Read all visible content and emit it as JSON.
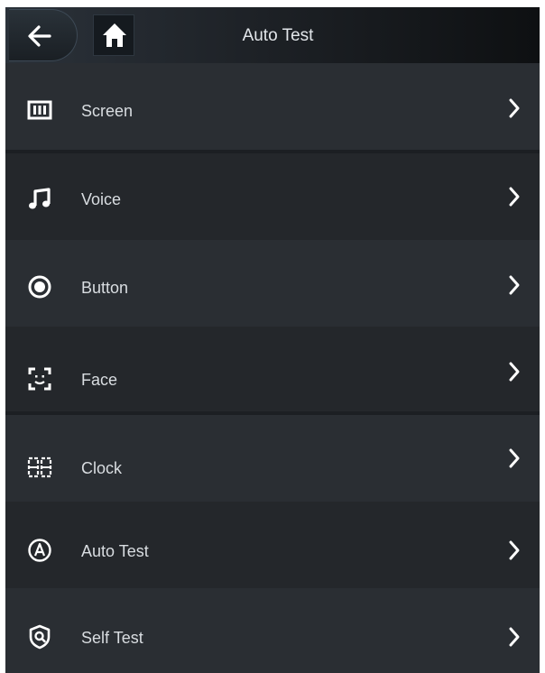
{
  "header": {
    "title": "Auto Test",
    "back_icon": "arrow-left-icon",
    "home_icon": "home-icon"
  },
  "menu": {
    "items": [
      {
        "label": "Screen",
        "icon": "screen-icon"
      },
      {
        "label": "Voice",
        "icon": "music-note-icon"
      },
      {
        "label": "Button",
        "icon": "radio-button-icon"
      },
      {
        "label": "Face",
        "icon": "face-scan-icon"
      },
      {
        "label": "Clock",
        "icon": "digital-clock-icon"
      },
      {
        "label": "Auto Test",
        "icon": "auto-circle-icon"
      },
      {
        "label": "Self Test",
        "icon": "shield-search-icon"
      }
    ]
  },
  "colors": {
    "background": "#26292e",
    "text": "#d9dde1",
    "icon": "#ffffff"
  }
}
